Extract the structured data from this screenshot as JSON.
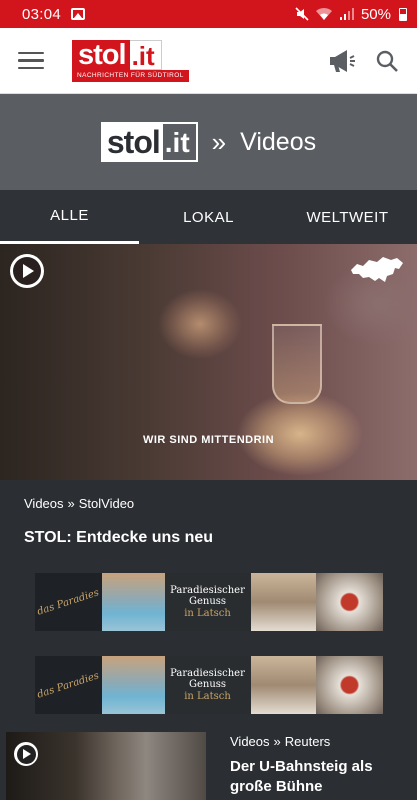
{
  "status_bar": {
    "time": "03:04",
    "battery": "50%"
  },
  "app_bar": {
    "logo_main": "stol",
    "logo_domain": ".it",
    "logo_tagline": "NACHRICHTEN FÜR SÜDTIROL"
  },
  "section_banner": {
    "logo_main": "stol",
    "logo_domain": ".it",
    "separator": "»",
    "title": "Videos"
  },
  "tabs": [
    {
      "label": "ALLE",
      "active": true
    },
    {
      "label": "LOKAL",
      "active": false
    },
    {
      "label": "WELTWEIT",
      "active": false
    }
  ],
  "hero": {
    "caption": "WIR SIND MITTENDRIN"
  },
  "featured": {
    "breadcrumb": [
      "Videos",
      "»",
      "StolVideo"
    ],
    "headline": "STOL: Entdecke uns neu"
  },
  "ads": [
    {
      "brand": "das Paradies",
      "line1": "Paradiesischer Genuss",
      "line2": "in Latsch"
    },
    {
      "brand": "das Paradies",
      "line1": "Paradiesischer Genuss",
      "line2": "in Latsch"
    }
  ],
  "video_item": {
    "breadcrumb": [
      "Videos",
      "»",
      "Reuters"
    ],
    "title": "Der U-Bahnsteig als große Bühne"
  }
}
